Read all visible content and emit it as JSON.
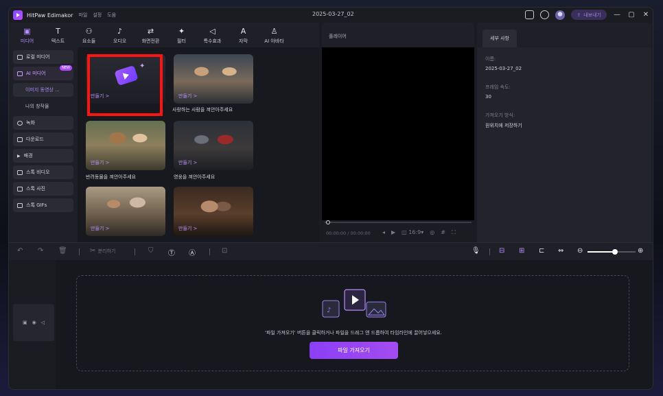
{
  "app": {
    "name": "HitPaw Edimakor",
    "menu": [
      "파일",
      "설정",
      "도움"
    ],
    "doc_title": "2025-03-27_02",
    "export_label": "내보내기"
  },
  "tools": [
    {
      "icon": "media-icon",
      "glyph": "▣",
      "label": "미디어",
      "active": true
    },
    {
      "icon": "text-icon",
      "glyph": "T",
      "label": "텍스트"
    },
    {
      "icon": "elements-icon",
      "glyph": "⚇",
      "label": "요소들"
    },
    {
      "icon": "audio-icon",
      "glyph": "♪",
      "label": "오디오"
    },
    {
      "icon": "transition-icon",
      "glyph": "⇄",
      "label": "화면전환"
    },
    {
      "icon": "filter-icon",
      "glyph": "✦",
      "label": "필터"
    },
    {
      "icon": "effects-icon",
      "glyph": "◁",
      "label": "특수효과"
    },
    {
      "icon": "subtitle-icon",
      "glyph": "A",
      "label": "자막"
    },
    {
      "icon": "ai-avatar-icon",
      "glyph": "♙",
      "label": "AI 아바타"
    }
  ],
  "sidebar": {
    "items": [
      {
        "label": "로컬 미디어"
      },
      {
        "label": "AI 미디어",
        "badge": "NEW"
      },
      {
        "label": "이미지 동영상 ..."
      },
      {
        "label": "나의 창작물"
      },
      {
        "label": "녹화"
      },
      {
        "label": "다운로드"
      },
      {
        "label": "배경"
      },
      {
        "label": "스톡 비디오"
      },
      {
        "label": "스톡 사진"
      },
      {
        "label": "스톡 GIFs"
      }
    ]
  },
  "gallery": {
    "create_label": "만들기 >",
    "captions": [
      "사랑하는 사람을 껴안아주세요",
      "반려동물을 껴안아주세요",
      "영웅을 껴안아주세요"
    ]
  },
  "player": {
    "title": "플레이어",
    "time": "00:00:00 / 00:00:00",
    "ratio": "16:9"
  },
  "details": {
    "tab": "세부 사항",
    "name_label": "이름:",
    "name_value": "2025-03-27_02",
    "fps_label": "프레임 속도:",
    "fps_value": "30",
    "import_label": "가져오기 방식:",
    "import_value": "원위치에 저장하기"
  },
  "timeline": {
    "split_label": "분리하기",
    "hint": "'파일 가져오기' 버튼을 클릭하거나 파일을 드래그 앤 드롭하여 타임라인에 끌어넣으세요.",
    "import_button": "파일 가져오기"
  }
}
